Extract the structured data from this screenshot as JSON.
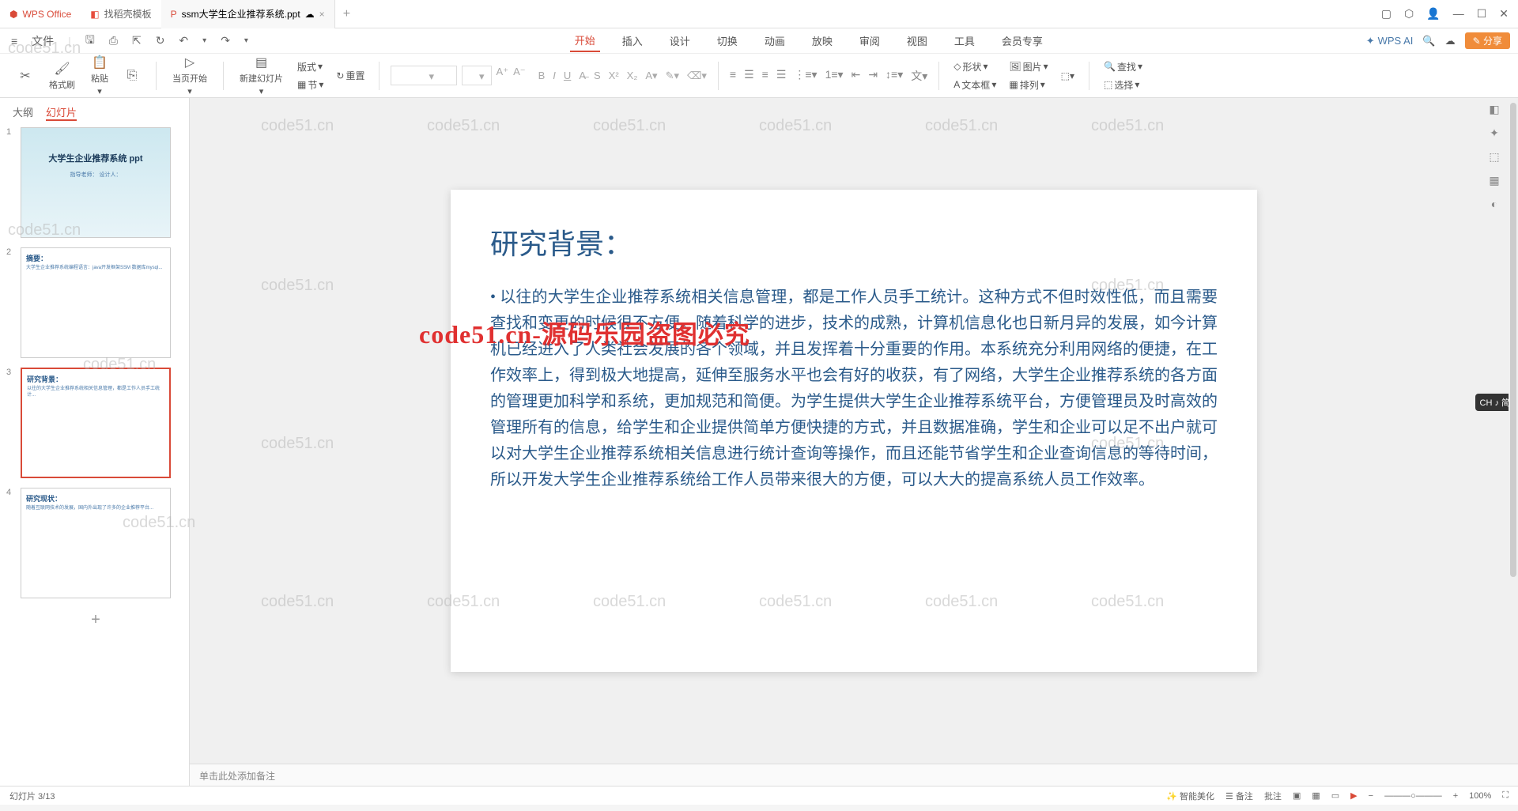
{
  "titlebar": {
    "app_name": "WPS Office",
    "template_tab": "找稻壳模板",
    "file_tab": "ssm大学生企业推荐系统.ppt",
    "cloud": "☁"
  },
  "win": {
    "box": "▢",
    "hex": "⬡",
    "user": "👤",
    "min": "—",
    "max": "☐",
    "close": "✕"
  },
  "filemenu": {
    "menu": "≡",
    "file": "文件",
    "save": "🖫",
    "print": "⎙",
    "export": "⇱",
    "refresh": "↻",
    "undo": "↶",
    "redo": "↷"
  },
  "tabs": [
    "开始",
    "插入",
    "设计",
    "切换",
    "动画",
    "放映",
    "审阅",
    "视图",
    "工具",
    "会员专享"
  ],
  "ai": "WPS AI",
  "share": "分享",
  "ribbon": {
    "cut": "✂",
    "copy": "⎘",
    "paste": "粘贴",
    "format": "格式刷",
    "newslide": "新建幻灯片",
    "slidefrom": "当页开始",
    "layout": "版式",
    "section": "节",
    "reset": "重置",
    "shape": "形状",
    "image": "图片",
    "textbox": "文本框",
    "arrange": "排列",
    "find": "查找",
    "select": "选择"
  },
  "panel": {
    "outline": "大纲",
    "slides": "幻灯片"
  },
  "thumbs": [
    {
      "n": "1",
      "title": "大学生企业推荐系统\nppt",
      "sub": "指导老师：\n设计人："
    },
    {
      "n": "2",
      "title": "摘要：",
      "body": "大学生企业推荐系统编程语言：java开发框架SSM 数据库mysql..."
    },
    {
      "n": "3",
      "title": "研究背景：",
      "body": "以往的大学生企业推荐系统相关信息管理，都是工作人员手工统计..."
    },
    {
      "n": "4",
      "title": "研究现状：",
      "body": "随着互联网技术的发展，国内外出现了许多的企业推荐平台..."
    }
  ],
  "slide": {
    "title": "研究背景：",
    "body": "以往的大学生企业推荐系统相关信息管理，都是工作人员手工统计。这种方式不但时效性低，而且需要查找和变更的时候很不方便。随着科学的进步，技术的成熟，计算机信息化也日新月异的发展，如今计算机已经进入了人类社会发展的各个领域，并且发挥着十分重要的作用。本系统充分利用网络的便捷，在工作效率上，得到极大地提高，延伸至服务水平也会有好的收获，有了网络，大学生企业推荐系统的各方面的管理更加科学和系统，更加规范和简便。为学生提供大学生企业推荐系统平台，方便管理员及时高效的管理所有的信息，给学生和企业提供简单方便快捷的方式，并且数据准确，学生和企业可以足不出户就可以对大学生企业推荐系统相关信息进行统计查询等操作，而且还能节省学生和企业查询信息的等待时间，所以开发大学生企业推荐系统给工作人员带来很大的方便，可以大大的提高系统人员工作效率。"
  },
  "notes": "单击此处添加备注",
  "red_wm": "code51.cn-源码乐园盗图必究",
  "wm": "code51.cn",
  "ime": "CH ♪ 简",
  "status": {
    "slide": "幻灯片 3/13",
    "zoom": "100%",
    "smart": "智能美化",
    "lec": "☰ 备注",
    "review": "批注"
  }
}
